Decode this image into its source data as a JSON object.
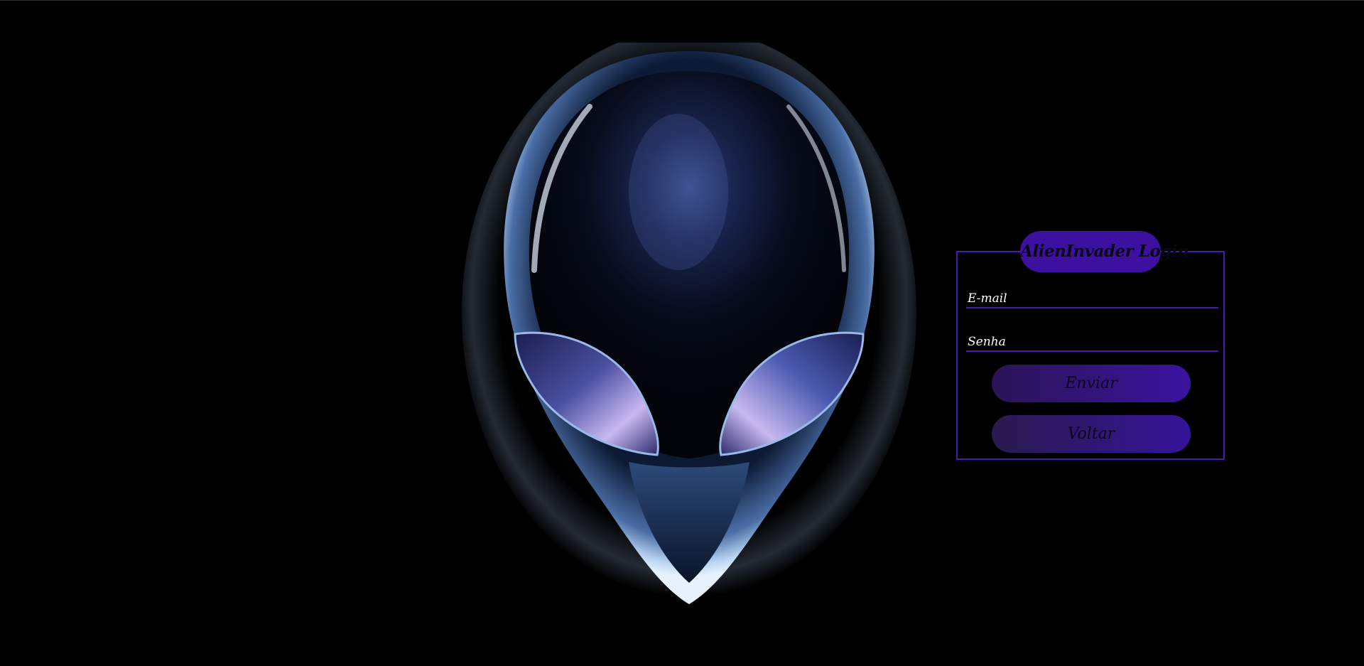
{
  "login": {
    "title": "AlienInvader Login",
    "email_label": "E-mail",
    "email_value": "",
    "password_label": "Senha",
    "password_value": "",
    "send_label": "Enviar",
    "back_label": "Voltar"
  },
  "background": {
    "image": "alien-head-icon"
  },
  "colors": {
    "accent": "#3d11a0",
    "border": "#4a1aa8",
    "background": "#000000",
    "label_text": "#ffffff"
  }
}
